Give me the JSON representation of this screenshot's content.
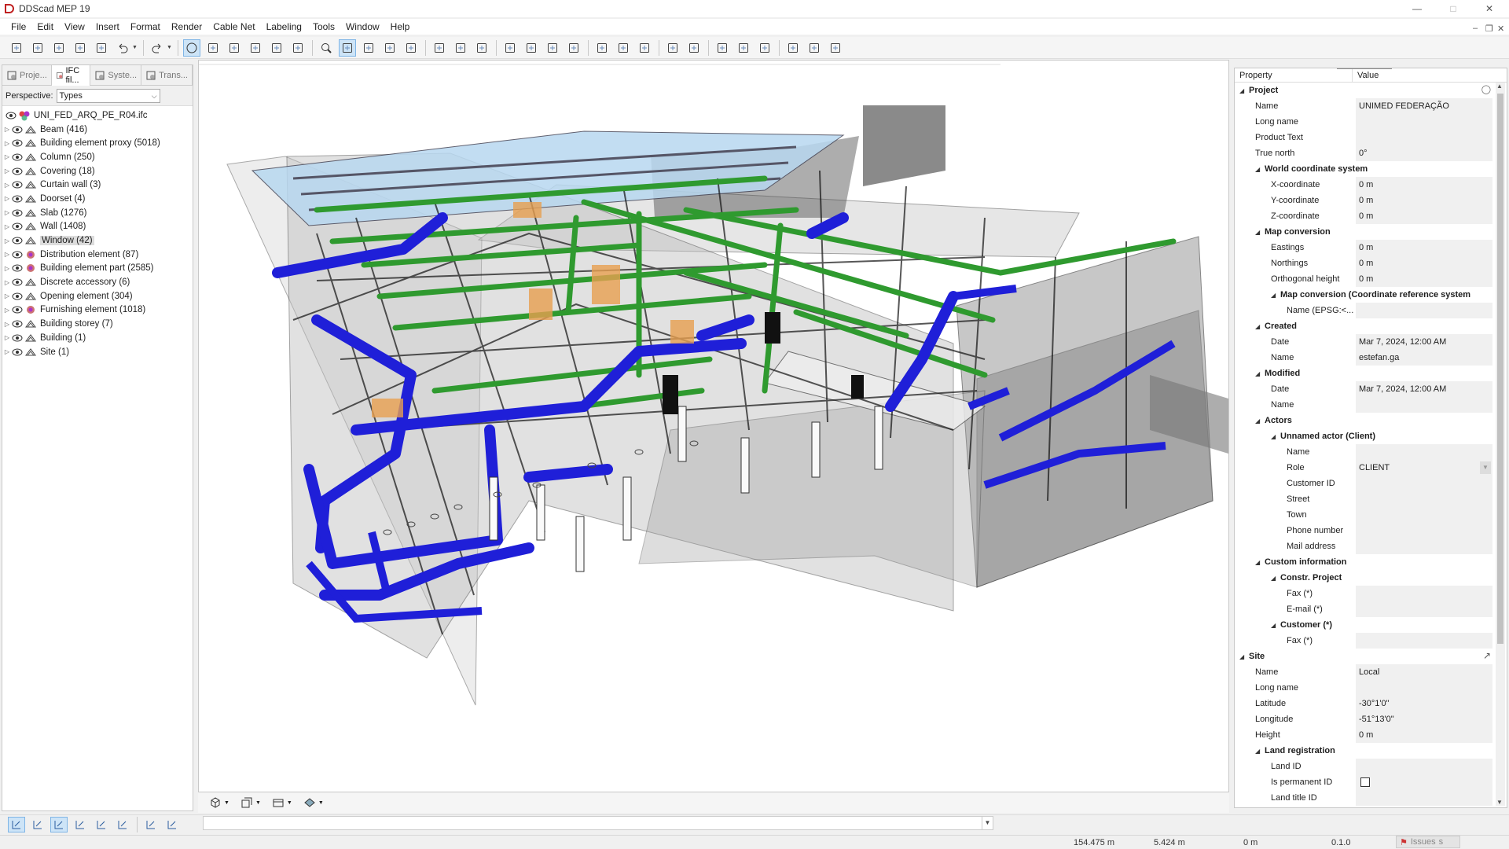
{
  "window": {
    "title": "DDScad MEP 19"
  },
  "menu": [
    "File",
    "Edit",
    "View",
    "Insert",
    "Format",
    "Render",
    "Cable Net",
    "Labeling",
    "Tools",
    "Window",
    "Help"
  ],
  "left_panel": {
    "tabs": [
      "Proje...",
      "IFC fil...",
      "Syste...",
      "Trans..."
    ],
    "perspective_label": "Perspective:",
    "perspective_value": "Types",
    "root": "UNI_FED_ARQ_PE_R04.ifc",
    "tree": [
      {
        "label": "Beam (416)",
        "icon": "beam-icon"
      },
      {
        "label": "Building element proxy (5018)",
        "icon": "proxy-icon"
      },
      {
        "label": "Column (250)",
        "icon": "column-icon"
      },
      {
        "label": "Covering (18)",
        "icon": "covering-icon"
      },
      {
        "label": "Curtain wall (3)",
        "icon": "curtain-wall-icon"
      },
      {
        "label": "Doorset (4)",
        "icon": "door-icon"
      },
      {
        "label": "Slab (1276)",
        "icon": "slab-icon"
      },
      {
        "label": "Wall (1408)",
        "icon": "wall-icon"
      },
      {
        "label": "Window (42)",
        "icon": "window-icon"
      },
      {
        "label": "Distribution element (87)",
        "icon": "distribution-icon"
      },
      {
        "label": "Building element part (2585)",
        "icon": "element-part-icon"
      },
      {
        "label": "Discrete accessory (6)",
        "icon": "accessory-icon"
      },
      {
        "label": "Opening element (304)",
        "icon": "opening-icon"
      },
      {
        "label": "Furnishing element (1018)",
        "icon": "furnishing-icon"
      },
      {
        "label": "Building storey (7)",
        "icon": "storey-icon"
      },
      {
        "label": "Building (1)",
        "icon": "building-icon"
      },
      {
        "label": "Site (1)",
        "icon": "site-icon"
      }
    ]
  },
  "properties": {
    "header": {
      "property": "Property",
      "value": "Value"
    },
    "rows": [
      {
        "name": "Project",
        "type": "group",
        "level": 0
      },
      {
        "name": "Name",
        "value": "UNIMED FEDERAÇÃO",
        "level": 1
      },
      {
        "name": "Long name",
        "value": "",
        "level": 1
      },
      {
        "name": "Product Text",
        "value": "",
        "level": 1
      },
      {
        "name": "True north",
        "value": "0°",
        "level": 1
      },
      {
        "name": "World coordinate system",
        "type": "group",
        "level": 1
      },
      {
        "name": "X-coordinate",
        "value": "0 m",
        "level": 2
      },
      {
        "name": "Y-coordinate",
        "value": "0 m",
        "level": 2
      },
      {
        "name": "Z-coordinate",
        "value": "0 m",
        "level": 2
      },
      {
        "name": "Map conversion",
        "type": "group",
        "level": 1
      },
      {
        "name": "Eastings",
        "value": "0 m",
        "level": 2
      },
      {
        "name": "Northings",
        "value": "0 m",
        "level": 2
      },
      {
        "name": "Orthogonal height",
        "value": "0 m",
        "level": 2
      },
      {
        "name": "Map conversion (Coordinate reference system)",
        "type": "group",
        "level": 2,
        "wide": true
      },
      {
        "name": "Name (EPSG:<...",
        "value": "",
        "level": 3
      },
      {
        "name": "Created",
        "type": "group",
        "level": 1
      },
      {
        "name": "Date",
        "value": "Mar 7, 2024, 12:00 AM",
        "level": 2
      },
      {
        "name": "Name",
        "value": "estefan.ga",
        "level": 2
      },
      {
        "name": "Modified",
        "type": "group",
        "level": 1
      },
      {
        "name": "Date",
        "value": "Mar 7, 2024, 12:00 AM",
        "level": 2
      },
      {
        "name": "Name",
        "value": "",
        "level": 2
      },
      {
        "name": "Actors",
        "type": "group",
        "level": 1
      },
      {
        "name": "Unnamed actor (Client)",
        "type": "group",
        "level": 2
      },
      {
        "name": "Name",
        "value": "",
        "level": 3
      },
      {
        "name": "Role",
        "value": "CLIENT",
        "level": 3,
        "dropdown": true
      },
      {
        "name": "Customer ID",
        "value": "",
        "level": 3
      },
      {
        "name": "Street",
        "value": "",
        "level": 3
      },
      {
        "name": "Town",
        "value": "",
        "level": 3
      },
      {
        "name": "Phone number",
        "value": "",
        "level": 3
      },
      {
        "name": "Mail address",
        "value": "",
        "level": 3
      },
      {
        "name": "Custom information",
        "type": "group",
        "level": 1
      },
      {
        "name": "Constr. Project",
        "type": "group",
        "level": 2
      },
      {
        "name": "Fax (*)",
        "value": "",
        "level": 3
      },
      {
        "name": "E-mail (*)",
        "value": "",
        "level": 3
      },
      {
        "name": "Customer (*)",
        "type": "group",
        "level": 2
      },
      {
        "name": "Fax (*)",
        "value": "",
        "level": 3
      },
      {
        "name": "Site",
        "type": "group",
        "level": 0,
        "link": true
      },
      {
        "name": "Name",
        "value": "Local",
        "level": 1
      },
      {
        "name": "Long name",
        "value": "",
        "level": 1
      },
      {
        "name": "Latitude",
        "value": "-30°1'0\"",
        "level": 1
      },
      {
        "name": "Longitude",
        "value": "-51°13'0\"",
        "level": 1
      },
      {
        "name": "Height",
        "value": "0 m",
        "level": 1
      },
      {
        "name": "Land registration",
        "type": "group",
        "level": 1
      },
      {
        "name": "Land ID",
        "value": "",
        "level": 2
      },
      {
        "name": "Is permanent ID",
        "value": "",
        "level": 2,
        "checkbox": true
      },
      {
        "name": "Land title ID",
        "value": "",
        "level": 2
      }
    ]
  },
  "status": {
    "x": "154.475 m",
    "y": "5.424 m",
    "z": "0 m",
    "version": "0.1.0",
    "issues": "Issues"
  },
  "colors": {
    "accent": "#7fb5e6",
    "duct_blue": "#1f1fd8",
    "pipe_green": "#2f9a2f",
    "selection": "#dcdcdc"
  }
}
